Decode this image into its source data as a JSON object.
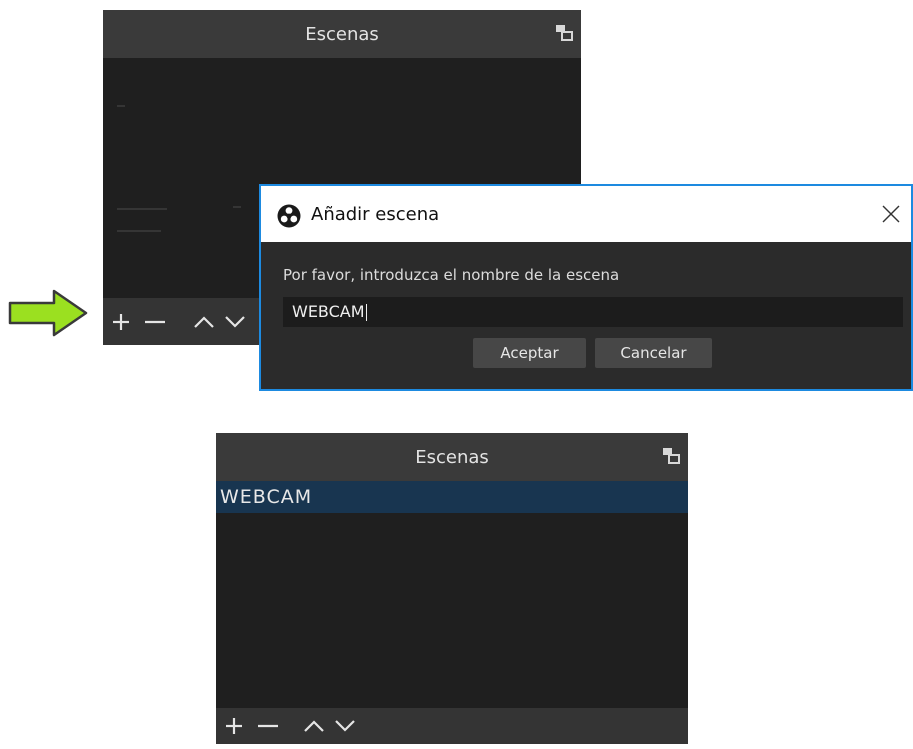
{
  "dock_top": {
    "title": "Escenas",
    "icons": [
      "float-icon",
      "add-icon",
      "remove-icon",
      "move-up-icon",
      "move-down-icon"
    ]
  },
  "dialog": {
    "title": "Añadir escena",
    "prompt": "Por favor, introduzca el nombre de la escena",
    "input_value": "WEBCAM",
    "ok_label": "Aceptar",
    "cancel_label": "Cancelar",
    "icons": [
      "obs-logo-icon",
      "close-icon"
    ]
  },
  "dock_bottom": {
    "title": "Escenas",
    "scenes": [
      "WEBCAM"
    ],
    "selected_scene": "WEBCAM"
  },
  "colors": {
    "dock_bg": "#2b2b2b",
    "header_bg": "#3a3a3a",
    "selection": "#183550",
    "dialog_border": "#1d8ae0",
    "arrow_fill": "#9be020"
  }
}
